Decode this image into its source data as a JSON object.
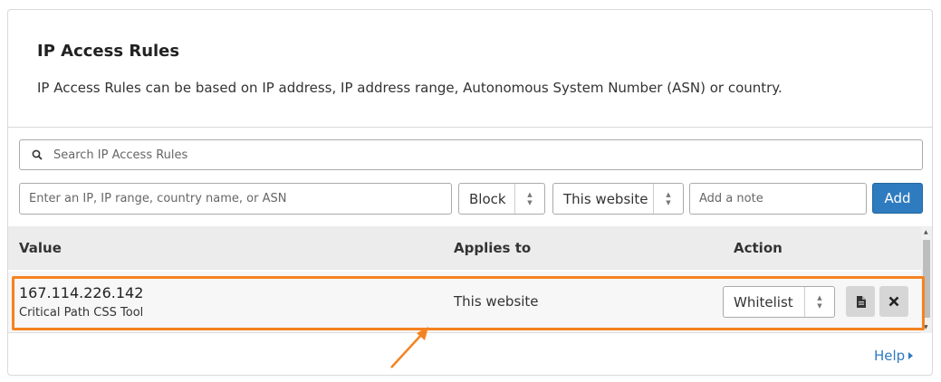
{
  "header": {
    "title": "IP Access Rules",
    "description": "IP Access Rules can be based on IP address, IP address range, Autonomous System Number (ASN) or country."
  },
  "search": {
    "placeholder": "Search IP Access Rules",
    "icon": "search-icon"
  },
  "add_form": {
    "ip_placeholder": "Enter an IP, IP range, country name, or ASN",
    "mode_value": "Block",
    "scope_value": "This website",
    "note_placeholder": "Add a note",
    "add_label": "Add"
  },
  "table": {
    "columns": [
      "Value",
      "Applies to",
      "Action"
    ],
    "rows": [
      {
        "value": "167.114.226.142",
        "note": "Critical Path CSS Tool",
        "applies_to": "This website",
        "action": "Whitelist"
      }
    ]
  },
  "footer": {
    "help_label": "Help"
  },
  "colors": {
    "accent": "#2f7bbf",
    "highlight": "#f58220"
  }
}
